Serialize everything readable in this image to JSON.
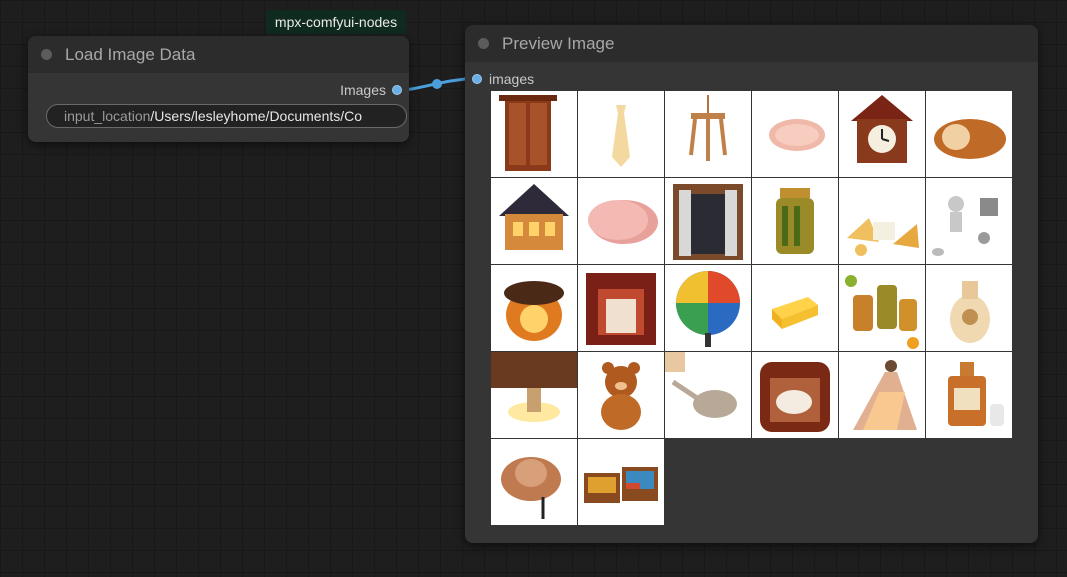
{
  "badge": "mpx-comfyui-nodes",
  "load_node": {
    "title": "Load Image Data",
    "output_label": "Images",
    "widget_name": "input_location",
    "widget_value": "/Users/lesleyhome/Documents/Co"
  },
  "preview_node": {
    "title": "Preview Image",
    "input_label": "images",
    "images": [
      "wardrobe-image",
      "necktie-image",
      "chandelier-image",
      "ham-slice-image",
      "cuckoo-clock-image",
      "bread-image",
      "house-image",
      "sliced-ham-image",
      "window-image",
      "pickle-jar-image",
      "cheese-platter-image",
      "figures-image",
      "acorn-lamp-image",
      "fireplace-image",
      "stained-glass-lamp-image",
      "cheese-block-image",
      "pickle-jars-image",
      "vase-image",
      "lantern-room-image",
      "teddy-bear-image",
      "spoon-image",
      "dog-bed-image",
      "dress-image",
      "perfume-bottle-image",
      "hat-image",
      "beds-image"
    ]
  },
  "colors": {
    "canvas": "#1e1e1e",
    "node_body": "#353535",
    "node_title": "#2c2c2c",
    "link": "#4a9fdc"
  }
}
